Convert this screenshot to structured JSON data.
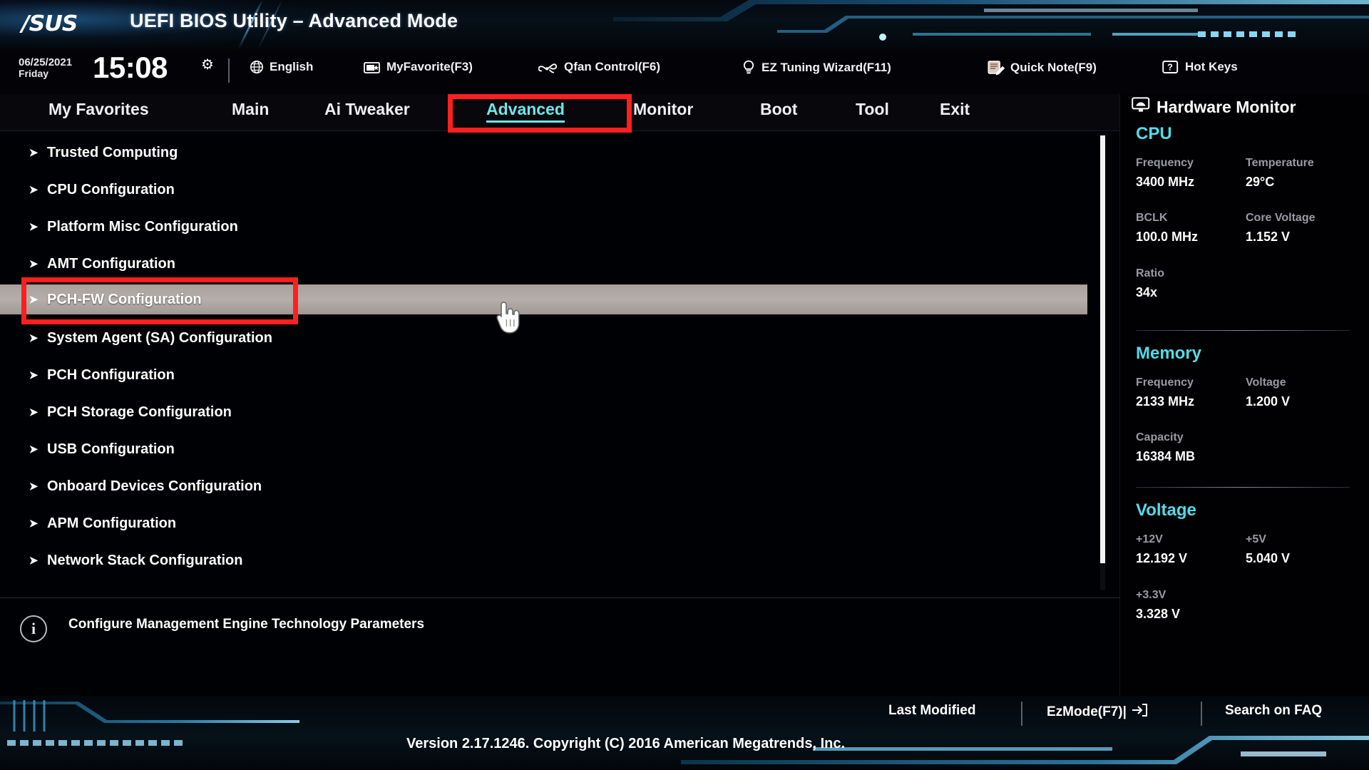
{
  "window": {
    "brand": "/SUS",
    "title": "UEFI BIOS Utility – Advanced Mode"
  },
  "infobar": {
    "date": "06/25/2021",
    "weekday": "Friday",
    "time": "15:08",
    "gear_icon": "gear-icon",
    "items": [
      {
        "label": "English",
        "icon": "globe-icon"
      },
      {
        "label": "MyFavorite(F3)",
        "icon": "folder-star-icon"
      },
      {
        "label": "Qfan Control(F6)",
        "icon": "fan-icon"
      },
      {
        "label": "EZ Tuning Wizard(F11)",
        "icon": "lightbulb-icon"
      },
      {
        "label": "Quick Note(F9)",
        "icon": "note-pencil-icon"
      },
      {
        "label": "Hot Keys",
        "icon": "question-key-icon"
      }
    ]
  },
  "nav": {
    "tabs": [
      {
        "label": "My Favorites",
        "active": false
      },
      {
        "label": "Main",
        "active": false
      },
      {
        "label": "Ai Tweaker",
        "active": false
      },
      {
        "label": "Advanced",
        "active": true
      },
      {
        "label": "Monitor",
        "active": false
      },
      {
        "label": "Boot",
        "active": false
      },
      {
        "label": "Tool",
        "active": false
      },
      {
        "label": "Exit",
        "active": false
      }
    ]
  },
  "menu": {
    "items": [
      {
        "label": "Trusted Computing",
        "selected": false
      },
      {
        "label": "CPU Configuration",
        "selected": false
      },
      {
        "label": "Platform Misc Configuration",
        "selected": false
      },
      {
        "label": "AMT Configuration",
        "selected": false
      },
      {
        "label": "PCH-FW Configuration",
        "selected": true
      },
      {
        "label": "System Agent (SA) Configuration",
        "selected": false
      },
      {
        "label": "PCH Configuration",
        "selected": false
      },
      {
        "label": "PCH Storage Configuration",
        "selected": false
      },
      {
        "label": "USB Configuration",
        "selected": false
      },
      {
        "label": "Onboard Devices Configuration",
        "selected": false
      },
      {
        "label": "APM Configuration",
        "selected": false
      },
      {
        "label": "Network Stack Configuration",
        "selected": false
      }
    ]
  },
  "help": {
    "icon": "info-icon",
    "text": "Configure Management Engine Technology Parameters"
  },
  "sidebar": {
    "title": "Hardware Monitor",
    "title_icon": "monitor-icon",
    "sections": [
      {
        "name": "CPU",
        "fields": [
          {
            "label": "Frequency",
            "value": "3400 MHz"
          },
          {
            "label": "Temperature",
            "value": "29°C"
          },
          {
            "label": "BCLK",
            "value": "100.0 MHz"
          },
          {
            "label": "Core Voltage",
            "value": "1.152 V"
          },
          {
            "label": "Ratio",
            "value": "34x"
          }
        ]
      },
      {
        "name": "Memory",
        "fields": [
          {
            "label": "Frequency",
            "value": "2133 MHz"
          },
          {
            "label": "Voltage",
            "value": "1.200 V"
          },
          {
            "label": "Capacity",
            "value": "16384 MB"
          }
        ]
      },
      {
        "name": "Voltage",
        "fields": [
          {
            "label": "+12V",
            "value": "12.192 V"
          },
          {
            "label": "+5V",
            "value": "5.040 V"
          },
          {
            "label": "+3.3V",
            "value": "3.328 V"
          }
        ]
      }
    ]
  },
  "bottombar": {
    "last_modified": "Last Modified",
    "ezmode": "EzMode(F7)|",
    "ezmode_icon": "exit-arrow-icon",
    "search_faq": "Search on FAQ",
    "version": "Version 2.17.1246. Copyright (C) 2016 American Megatrends, Inc."
  },
  "annotations": {
    "accent_red": "#ff1f1f",
    "boxes": [
      {
        "target": "Advanced"
      },
      {
        "target": "PCH-FW Configuration"
      }
    ]
  },
  "colors": {
    "accent_cyan": "#55dbe8",
    "active_tab": "#6fe6ea",
    "selection_gray": "#b6aeaa",
    "background": "#000105",
    "annotation_red": "#ff1f1f"
  },
  "cursor": {
    "icon": "hand-pointer-cursor"
  }
}
